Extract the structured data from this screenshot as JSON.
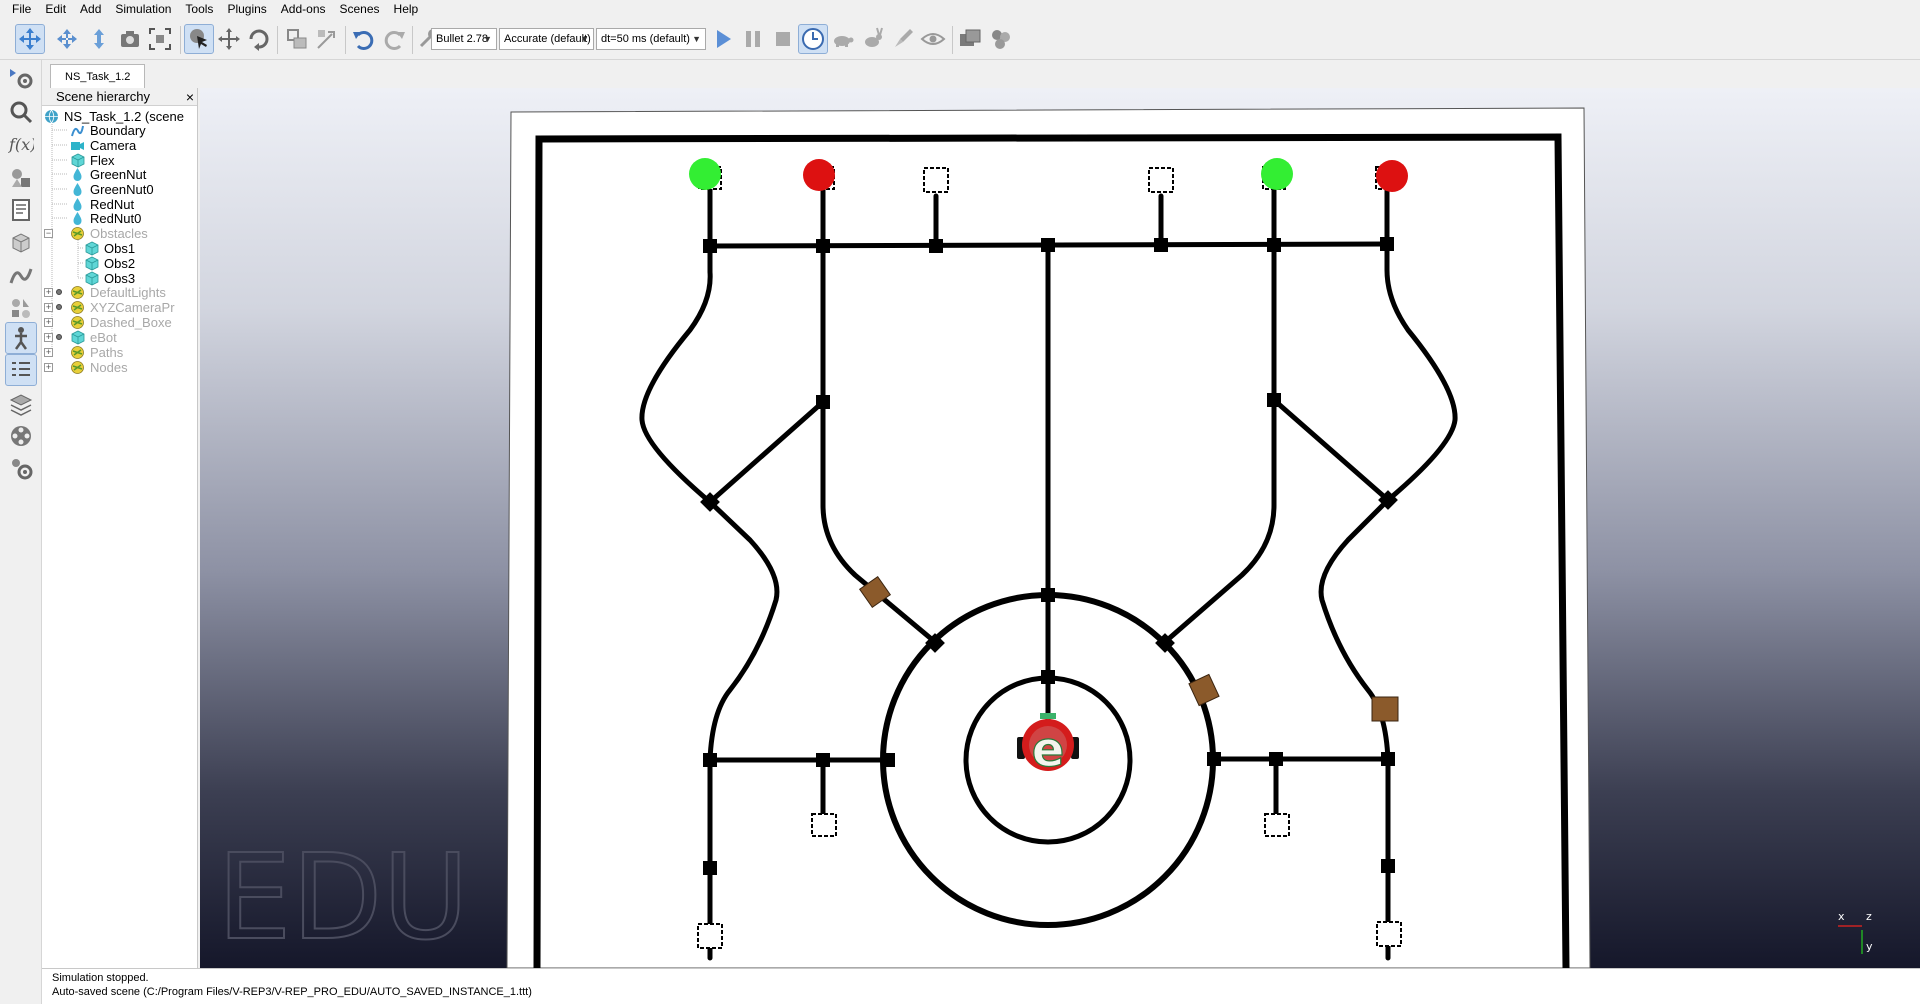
{
  "menu": [
    "File",
    "Edit",
    "Add",
    "Simulation",
    "Tools",
    "Plugins",
    "Add-ons",
    "Scenes",
    "Help"
  ],
  "toolbar": {
    "engine": "Bullet 2.78",
    "accuracy": "Accurate (default)",
    "timestep": "dt=50 ms (default)"
  },
  "tab_label": "NS_Task_1.2",
  "hierarchy": {
    "title": "Scene hierarchy",
    "close": "×",
    "items": [
      {
        "label": "NS_Task_1.2 (scene",
        "icon": "globe-icon"
      },
      {
        "label": "Boundary",
        "icon": "path-icon"
      },
      {
        "label": "Camera",
        "icon": "camera-icon"
      },
      {
        "label": "Flex",
        "icon": "cube-icon"
      },
      {
        "label": "GreenNut",
        "icon": "drop-icon"
      },
      {
        "label": "GreenNut0",
        "icon": "drop-icon"
      },
      {
        "label": "RedNut",
        "icon": "drop-icon"
      },
      {
        "label": "RedNut0",
        "icon": "drop-icon"
      },
      {
        "label": "Obstacles",
        "icon": "dummy-icon"
      },
      {
        "label": "Obs1",
        "icon": "cube-icon"
      },
      {
        "label": "Obs2",
        "icon": "cube-icon"
      },
      {
        "label": "Obs3",
        "icon": "cube-icon"
      },
      {
        "label": "DefaultLights",
        "icon": "dummy-icon"
      },
      {
        "label": "XYZCameraPr",
        "icon": "dummy-icon"
      },
      {
        "label": "Dashed_Boxe",
        "icon": "dummy-icon"
      },
      {
        "label": "eBot",
        "icon": "cube-icon"
      },
      {
        "label": "Paths",
        "icon": "dummy-icon"
      },
      {
        "label": "Nodes",
        "icon": "dummy-icon"
      }
    ]
  },
  "viewport": {
    "watermark": "EDU",
    "robot_letter": "e",
    "axes": {
      "x": "x",
      "y": "y",
      "z": "z"
    }
  },
  "status": {
    "line1": "Simulation stopped.",
    "line2": "Auto-saved scene (C:/Program Files/V-REP3/V-REP_PRO_EDU/AUTO_SAVED_INSTANCE_1.ttt)"
  },
  "colors": {
    "nut_green": "#33ee33",
    "nut_red": "#dd1111",
    "obstacle": "#8b5a2b",
    "robot_ring": "#d41c1c",
    "robot_letter": "#f4f4ee",
    "active_button": "#cfe0f4"
  }
}
